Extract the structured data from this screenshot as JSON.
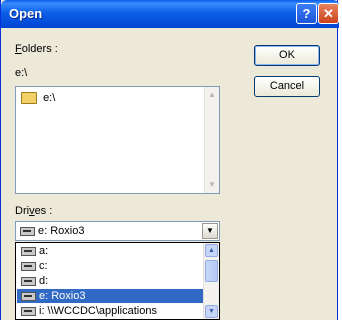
{
  "window": {
    "title": "Open",
    "help_glyph": "?",
    "close_glyph": "✕"
  },
  "folders": {
    "label_key": "F",
    "label_rest": "olders :",
    "current_path": "e:\\",
    "items": [
      {
        "label": "e:\\",
        "icon": "open-folder-icon"
      }
    ]
  },
  "buttons": {
    "ok": "OK",
    "cancel": "Cancel"
  },
  "drives": {
    "label_pre": "Dri",
    "label_key": "v",
    "label_post": "es :",
    "selected": "e: Roxio3",
    "options": [
      {
        "label": "a:",
        "selected": false
      },
      {
        "label": "c:",
        "selected": false
      },
      {
        "label": "d:",
        "selected": false
      },
      {
        "label": "e: Roxio3",
        "selected": true
      },
      {
        "label": "i: \\\\WCCDC\\applications",
        "selected": false
      }
    ]
  },
  "icons": {
    "drive": "drive-icon",
    "folder": "open-folder-icon",
    "scroll_up": "scroll-up-arrow-icon",
    "scroll_down": "scroll-down-arrow-icon",
    "dropdown": "dropdown-arrow-icon"
  },
  "colors": {
    "titlebar": "#0054e3",
    "selection": "#316ac5",
    "dialog_face": "#ece9d8"
  }
}
